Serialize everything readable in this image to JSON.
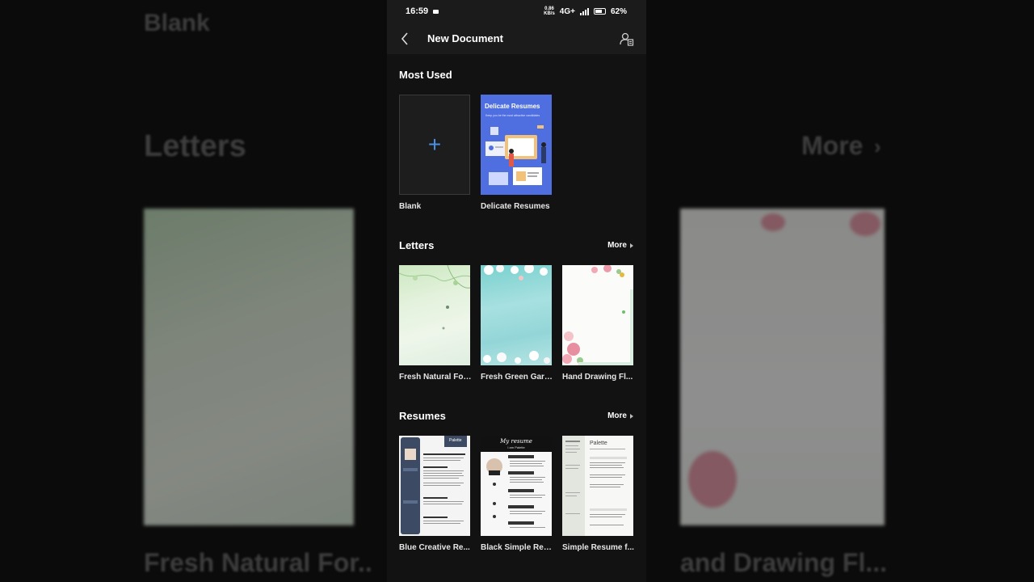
{
  "status_bar": {
    "time": "16:59",
    "speed_value": "0.86",
    "speed_unit": "KB/s",
    "network": "4G+",
    "battery": "62%"
  },
  "app_bar": {
    "title": "New Document",
    "back_icon": "chevron-left-icon",
    "account_icon": "account-document-icon"
  },
  "sections": {
    "most_used": {
      "title": "Most Used",
      "items": [
        {
          "label": "Blank"
        },
        {
          "label": "Delicate Resumes",
          "thumb_title": "Delicate Resumes",
          "thumb_subtitle": "Keep you be the most attractive candidates"
        }
      ]
    },
    "letters": {
      "title": "Letters",
      "more_label": "More",
      "items": [
        {
          "label": "Fresh Natural For..."
        },
        {
          "label": "Fresh Green Gard..."
        },
        {
          "label": "Hand Drawing Fl..."
        }
      ]
    },
    "resumes": {
      "title": "Resumes",
      "more_label": "More",
      "items": [
        {
          "label": "Blue Creative Re...",
          "thumb_name": "Palette"
        },
        {
          "label": "Black Simple Res...",
          "thumb_title": "My resume",
          "thumb_name": "I am Palette"
        },
        {
          "label": "Simple Resume f...",
          "thumb_name": "Palette"
        }
      ]
    }
  },
  "background_echo": {
    "blank": "Blank",
    "letters": "Letters",
    "more": "More",
    "bottom_left": "Fresh Natural For..",
    "bottom_right": "and Drawing Fl..."
  },
  "colors": {
    "accent": "#4a90e2",
    "panel_bg": "#121212",
    "bar_bg": "#1b1b1b"
  }
}
